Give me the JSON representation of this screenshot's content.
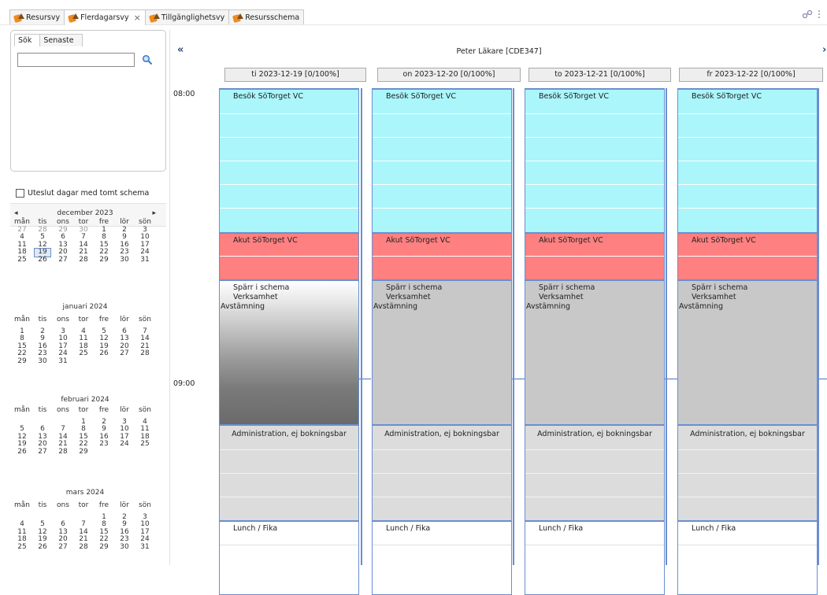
{
  "tabs": [
    {
      "label": "Resursvy"
    },
    {
      "label": "Flerdagarsvy",
      "closable": true
    },
    {
      "label": "Tillgänglighetsvy"
    },
    {
      "label": "Resursschema"
    }
  ],
  "tab_close_glyph": "×",
  "left": {
    "search_tab": "Sök",
    "recent_tab": "Senaste",
    "search_value": "",
    "exclude_label": "Uteslut dagar med tomt schema"
  },
  "calendar": {
    "weekdays": [
      "mån",
      "tis",
      "ons",
      "tor",
      "fre",
      "lör",
      "sön"
    ],
    "prev_glyph": "◂",
    "next_glyph": "▸",
    "months": [
      {
        "title": "december 2023",
        "cells": [
          "27",
          "28",
          "29",
          "30",
          "1",
          "2",
          "3",
          "4",
          "5",
          "6",
          "7",
          "8",
          "9",
          "10",
          "11",
          "12",
          "13",
          "14",
          "15",
          "16",
          "17",
          "18",
          "19",
          "20",
          "21",
          "22",
          "23",
          "24",
          "25",
          "26",
          "27",
          "28",
          "29",
          "30",
          "31"
        ]
      },
      {
        "title": "januari 2024",
        "cells": [
          "1",
          "2",
          "3",
          "4",
          "5",
          "6",
          "7",
          "8",
          "9",
          "10",
          "11",
          "12",
          "13",
          "14",
          "15",
          "16",
          "17",
          "18",
          "19",
          "20",
          "21",
          "22",
          "23",
          "24",
          "25",
          "26",
          "27",
          "28",
          "29",
          "30",
          "31"
        ]
      },
      {
        "title": "februari 2024",
        "cells": [
          "",
          "",
          "",
          "1",
          "2",
          "3",
          "4",
          "5",
          "6",
          "7",
          "8",
          "9",
          "10",
          "11",
          "12",
          "13",
          "14",
          "15",
          "16",
          "17",
          "18",
          "19",
          "20",
          "21",
          "22",
          "23",
          "24",
          "25",
          "26",
          "27",
          "28",
          "29"
        ]
      },
      {
        "title": "mars 2024",
        "cells": [
          "",
          "",
          "",
          "",
          "1",
          "2",
          "3",
          "4",
          "5",
          "6",
          "7",
          "8",
          "9",
          "10",
          "11",
          "12",
          "13",
          "14",
          "15",
          "16",
          "17",
          "18",
          "19",
          "20",
          "21",
          "22",
          "23",
          "24",
          "25",
          "26",
          "27",
          "28",
          "29",
          "30",
          "31"
        ]
      }
    ]
  },
  "schedule": {
    "resource": "Peter Läkare [CDE347]",
    "prev": "«",
    "next": "›",
    "times": [
      "08:00",
      "09:00"
    ],
    "days": [
      {
        "header": "ti 2023-12-19  [0/100%]"
      },
      {
        "header": "on 2023-12-20  [0/100%]"
      },
      {
        "header": "to 2023-12-21  [0/100%]"
      },
      {
        "header": "fr 2023-12-22  [0/100%]"
      }
    ],
    "blocks": {
      "visit": "Besök SöTorget VC",
      "acute": "Akut SöTorget VC",
      "block1": "Spärr i schema",
      "block2": "Verksamhet",
      "block3": "Avstämning",
      "admin": "Administration, ej bokningsbar",
      "lunch": "Lunch / Fika"
    }
  }
}
